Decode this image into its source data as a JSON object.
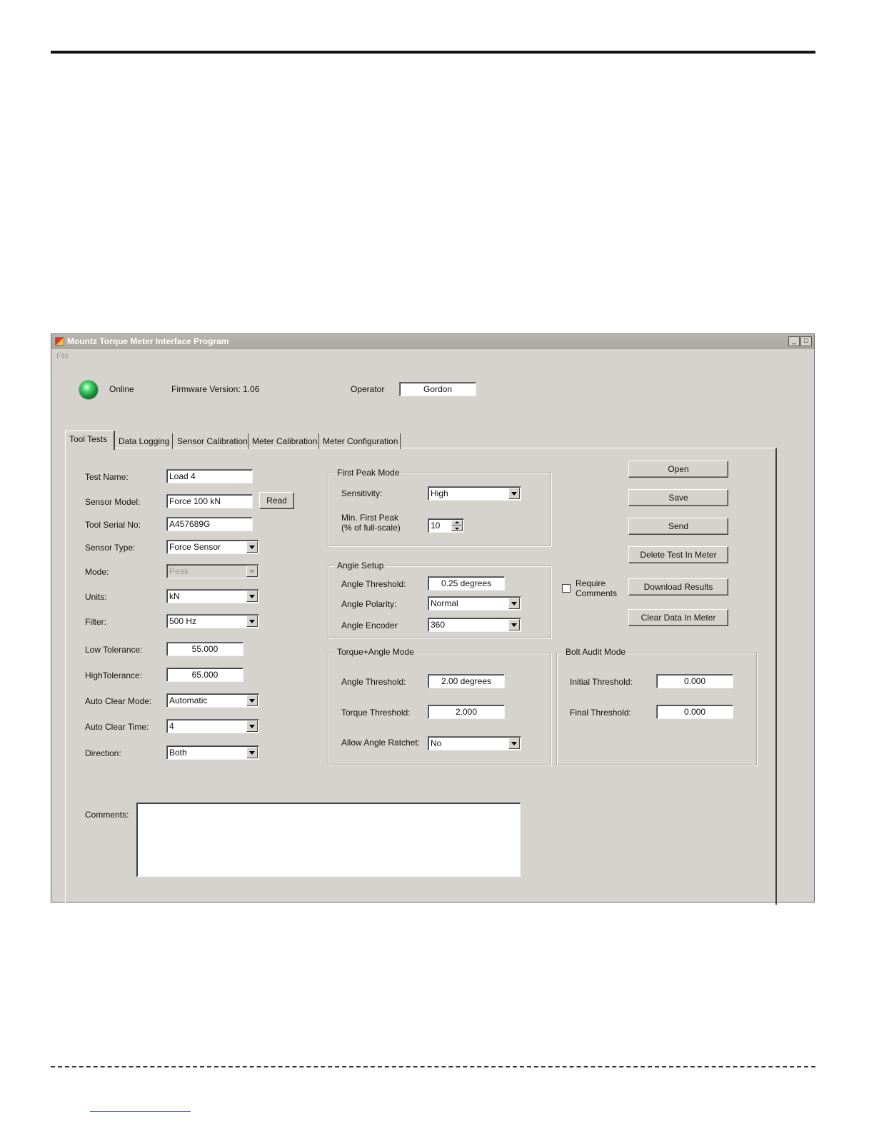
{
  "window": {
    "title": "Mountz Torque Meter Interface Program",
    "menu_file": "File",
    "minimize": "_",
    "maximize": "□"
  },
  "status": {
    "online_label": "Online",
    "firmware": "Firmware Version: 1.06",
    "operator_label": "Operator",
    "operator_value": "Gordon"
  },
  "tabs": [
    {
      "label": "Tool Tests"
    },
    {
      "label": "Data Logging"
    },
    {
      "label": "Sensor Calibration"
    },
    {
      "label": "Meter Calibration"
    },
    {
      "label": "Meter Configuration"
    }
  ],
  "tool": {
    "test_name_label": "Test Name:",
    "test_name": "Load 4",
    "sensor_model_label": "Sensor Model:",
    "sensor_model": "Force 100 kN",
    "read_button": "Read",
    "serial_label": "Tool Serial No:",
    "serial": "A457689G",
    "sensor_type_label": "Sensor Type:",
    "sensor_type": "Force Sensor",
    "mode_label": "Mode:",
    "mode": "Peak",
    "units_label": "Units:",
    "units": "kN",
    "filter_label": "Filter:",
    "filter": "500 Hz",
    "low_tol_label": "Low Tolerance:",
    "low_tol": "55.000",
    "high_tol_label": "HighTolerance:",
    "high_tol": "65.000",
    "auto_clear_mode_label": "Auto Clear Mode:",
    "auto_clear_mode": "Automatic",
    "auto_clear_time_label": "Auto Clear Time:",
    "auto_clear_time": "4",
    "direction_label": "Direction:",
    "direction": "Both",
    "comments_label": "Comments:",
    "comments": ""
  },
  "first_peak": {
    "title": "First Peak Mode",
    "sensitivity_label": "Sensitivity:",
    "sensitivity": "High",
    "min_peak_label_1": "Min. First Peak",
    "min_peak_label_2": "(% of full-scale)",
    "min_peak": "10"
  },
  "angle_setup": {
    "title": "Angle Setup",
    "threshold_label": "Angle Threshold:",
    "threshold": "0.25 degrees",
    "polarity_label": "Angle Polarity:",
    "polarity": "Normal",
    "encoder_label": "Angle Encoder",
    "encoder": "360"
  },
  "torque_angle": {
    "title": "Torque+Angle Mode",
    "angle_threshold_label": "Angle Threshold:",
    "angle_threshold": "2.00 degrees",
    "torque_threshold_label": "Torque Threshold:",
    "torque_threshold": "2.000",
    "ratchet_label": "Allow Angle Ratchet:",
    "ratchet": "No"
  },
  "bolt_audit": {
    "title": "Bolt Audit Mode",
    "initial_label": "Initial Threshold:",
    "initial": "0.000",
    "final_label": "Final Threshold:",
    "final": "0.000"
  },
  "actions": {
    "open": "Open",
    "save": "Save",
    "send": "Send",
    "delete": "Delete Test In Meter",
    "download": "Download Results",
    "clear": "Clear Data In Meter",
    "require_comments_1": "Require",
    "require_comments_2": "Comments"
  },
  "colors": {
    "window_bg": "#d6d3ce",
    "led": "#1fae4a"
  }
}
